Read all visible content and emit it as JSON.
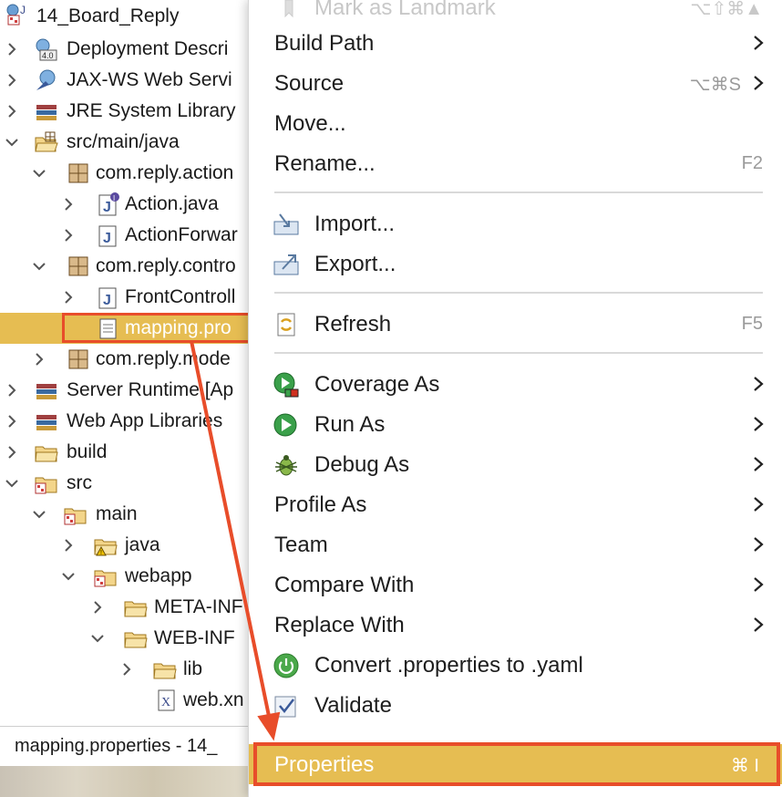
{
  "tree": {
    "project": "14_Board_Reply",
    "rows": [
      {
        "label": "Deployment Descri"
      },
      {
        "label": "JAX-WS Web Servi"
      },
      {
        "label": "JRE System Library"
      },
      {
        "label": "src/main/java"
      },
      {
        "label": "com.reply.action"
      },
      {
        "label": "Action.java"
      },
      {
        "label": "ActionForwar"
      },
      {
        "label": "com.reply.contro"
      },
      {
        "label": "FrontControll"
      },
      {
        "label": "mapping.pro"
      },
      {
        "label": "com.reply.mode"
      },
      {
        "label": "Server Runtime [Ap"
      },
      {
        "label": "Web App Libraries"
      },
      {
        "label": "build"
      },
      {
        "label": "src"
      },
      {
        "label": "main"
      },
      {
        "label": "java"
      },
      {
        "label": "webapp"
      },
      {
        "label": "META-INF"
      },
      {
        "label": "WEB-INF"
      },
      {
        "label": "lib"
      },
      {
        "label": "web.xn"
      }
    ]
  },
  "status_bar": {
    "text": "mapping.properties - 14_"
  },
  "context_menu": {
    "items": [
      {
        "label": "Mark as Landmark",
        "shortcut": "⌥⇧⌘▲",
        "faded": true
      },
      {
        "label": "Build Path",
        "submenu": true
      },
      {
        "label": "Source",
        "shortcut": "⌥⌘S",
        "submenu": true
      },
      {
        "label": "Move..."
      },
      {
        "label": "Rename...",
        "shortcut": "F2"
      },
      {
        "label": "Import..."
      },
      {
        "label": "Export..."
      },
      {
        "label": "Refresh",
        "shortcut": "F5"
      },
      {
        "label": "Coverage As",
        "submenu": true
      },
      {
        "label": "Run As",
        "submenu": true
      },
      {
        "label": "Debug As",
        "submenu": true
      },
      {
        "label": "Profile As",
        "submenu": true
      },
      {
        "label": "Team",
        "submenu": true
      },
      {
        "label": "Compare With",
        "submenu": true
      },
      {
        "label": "Replace With",
        "submenu": true
      },
      {
        "label": "Convert .properties to .yaml"
      },
      {
        "label": "Validate"
      },
      {
        "label": "Properties",
        "shortcut": "⌘ I",
        "highlighted": true
      }
    ]
  },
  "colors": {
    "selection": "#e6bd52",
    "annotation": "#e84d2a"
  }
}
